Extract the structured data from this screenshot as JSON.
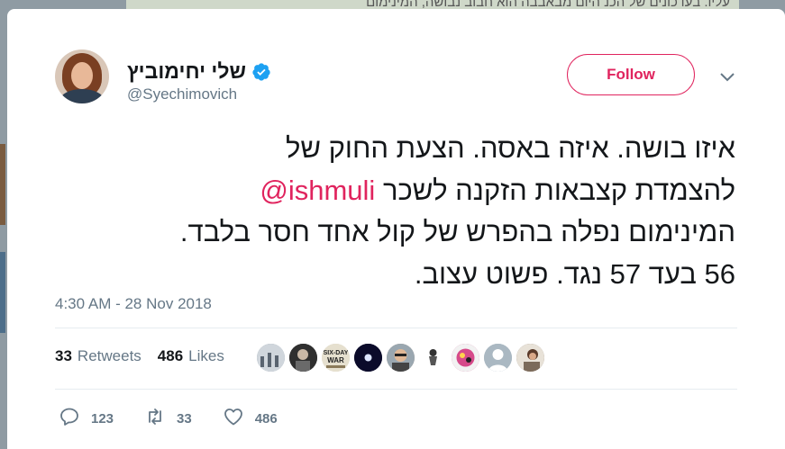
{
  "background": {
    "top_text": "עליו. בעדכונים של הכנ היום מבאבבה הוא חבוב נבושה, המינימום"
  },
  "tweet": {
    "author": {
      "display_name": "שלי יחימוביץ",
      "handle": "@Syechimovich",
      "verified": true
    },
    "follow_label": "Follow",
    "text_lines": [
      "איזו בושה. איזה באסה. הצעת החוק של",
      "להצמדת קצבאות הזקנה לשכר",
      "המינימום נפלה בהפרש של קול אחד חסר בלבד.",
      "56 בעד 57 נגד. פשוט עצוב."
    ],
    "mention": "@ishmuli",
    "timestamp": "4:30 AM - 28 Nov 2018",
    "retweets_count": "33",
    "retweets_label": "Retweets",
    "likes_count": "486",
    "likes_label": "Likes",
    "likers": [
      {
        "name": "liker-1",
        "color": "#8a9aa8"
      },
      {
        "name": "liker-2",
        "color": "#3b3b3b"
      },
      {
        "name": "liker-3",
        "label": "SIX-DAY WAR",
        "color": "#d8d2c0"
      },
      {
        "name": "liker-4",
        "color": "#0b0b2a"
      },
      {
        "name": "liker-5",
        "color": "#b49a84"
      },
      {
        "name": "liker-6",
        "color": "#ffffff"
      },
      {
        "name": "liker-7",
        "color": "#c23c7c"
      },
      {
        "name": "liker-8",
        "color": "#aab8c2"
      },
      {
        "name": "liker-9",
        "color": "#7b6a5a"
      }
    ],
    "actions": {
      "replies": "123",
      "retweets": "33",
      "likes": "486"
    }
  },
  "colors": {
    "accent": "#e0245e",
    "verified": "#1da1f2",
    "secondary_text": "#657786"
  }
}
